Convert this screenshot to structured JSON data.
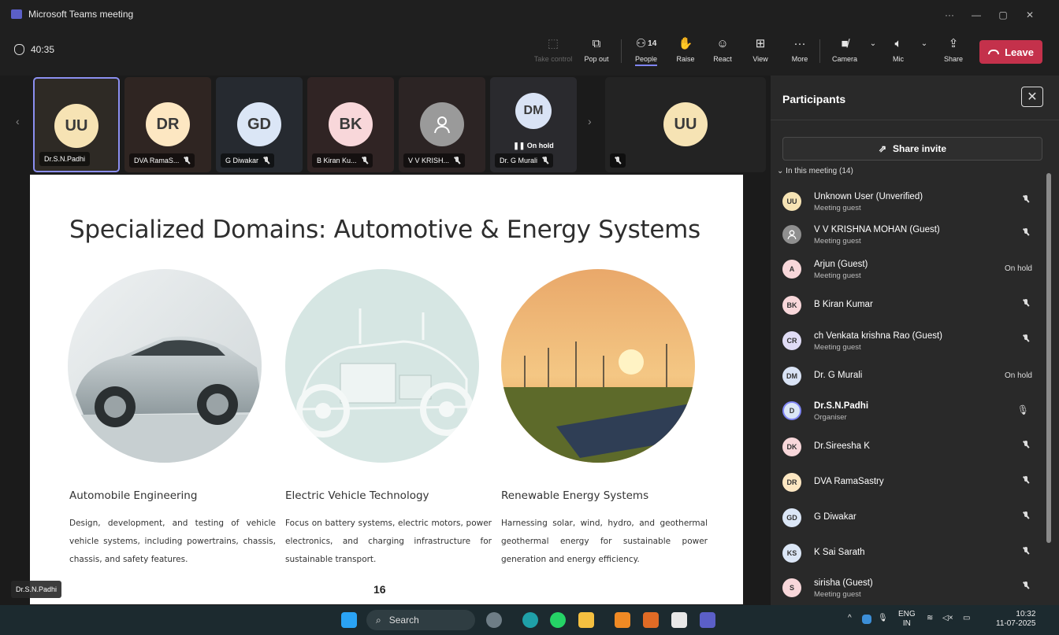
{
  "window": {
    "title": "Microsoft Teams meeting",
    "more": "···",
    "minimize": "—",
    "restore": "▢",
    "close": "✕"
  },
  "toolbar": {
    "timer": "40:35",
    "take_control": "Take control",
    "pop_out": "Pop out",
    "people": "People",
    "people_count": "14",
    "raise": "Raise",
    "react": "React",
    "view": "View",
    "more": "More",
    "camera": "Camera",
    "mic": "Mic",
    "share": "Share",
    "leave": "Leave"
  },
  "gallery": {
    "tiles": [
      {
        "initials": "UU",
        "name": "Dr.S.N.Padhi",
        "color": "#f6e3b4"
      },
      {
        "initials": "DR",
        "name": "DVA RamaS...",
        "color": "#fde7c2"
      },
      {
        "initials": "GD",
        "name": "G Diwakar",
        "color": "#dbe6f6"
      },
      {
        "initials": "BK",
        "name": "B Kiran Ku...",
        "color": "#f8d7da"
      },
      {
        "initials": "",
        "name": "V V KRISH...",
        "color": "#9a9a9a"
      },
      {
        "initials": "DM",
        "name": "Dr. G Murali",
        "color": "#d9e3f5",
        "status": "On hold"
      },
      {
        "initials": "UU",
        "name": "",
        "color": "#f6e3b4"
      }
    ]
  },
  "slide": {
    "title": "Specialized Domains: Automotive & Energy Systems",
    "columns": [
      {
        "title": "Automobile Engineering",
        "text": "Design, development, and testing of vehicle vehicle systems, including powertrains, chassis, chassis, and safety features."
      },
      {
        "title": "Electric Vehicle Technology",
        "text": "Focus on battery systems, electric motors, power electronics, and charging infrastructure for sustainable transport."
      },
      {
        "title": "Renewable Energy Systems",
        "text": "Harnessing solar, wind, hydro, and geothermal geothermal energy for sustainable power generation and energy efficiency."
      }
    ],
    "page_number": "16",
    "presenter": "Dr.S.N.Padhi"
  },
  "panel": {
    "title": "Participants",
    "share_invite": "Share invite",
    "in_meeting": "In this meeting (14)",
    "participants": [
      {
        "initials": "UU",
        "name": "Unknown User (Unverified)",
        "sub": "Meeting guest",
        "status": "muted",
        "color": "#f6e3b4"
      },
      {
        "initials": "",
        "name": "V V KRISHNA MOHAN (Guest)",
        "sub": "Meeting guest",
        "status": "muted",
        "color": "#8f8f8f"
      },
      {
        "initials": "A",
        "name": "Arjun (Guest)",
        "sub": "Meeting guest",
        "status": "On hold",
        "color": "#f8d7da"
      },
      {
        "initials": "BK",
        "name": "B Kiran Kumar",
        "sub": "",
        "status": "muted",
        "color": "#f8d7da"
      },
      {
        "initials": "CR",
        "name": "ch Venkata krishna Rao (Guest)",
        "sub": "Meeting guest",
        "status": "muted",
        "color": "#e0dcf5"
      },
      {
        "initials": "DM",
        "name": "Dr. G Murali",
        "sub": "",
        "status": "On hold",
        "color": "#d9e3f5"
      },
      {
        "initials": "D",
        "name": "Dr.S.N.Padhi",
        "sub": "Organiser",
        "status": "mic",
        "color": "#dbe6f6"
      },
      {
        "initials": "DK",
        "name": "Dr.Sireesha K",
        "sub": "",
        "status": "muted",
        "color": "#f8d7da"
      },
      {
        "initials": "DR",
        "name": "DVA RamaSastry",
        "sub": "",
        "status": "muted",
        "color": "#fde7c2"
      },
      {
        "initials": "GD",
        "name": "G Diwakar",
        "sub": "",
        "status": "muted",
        "color": "#dbe6f6"
      },
      {
        "initials": "KS",
        "name": "K Sai Sarath",
        "sub": "",
        "status": "muted",
        "color": "#dbe6f6"
      },
      {
        "initials": "S",
        "name": "sirisha (Guest)",
        "sub": "Meeting guest",
        "status": "muted",
        "color": "#f8d7da"
      }
    ]
  },
  "taskbar": {
    "search": "Search",
    "lang": "ENG",
    "region": "IN",
    "time": "10:32",
    "date": "11-07-2025"
  }
}
